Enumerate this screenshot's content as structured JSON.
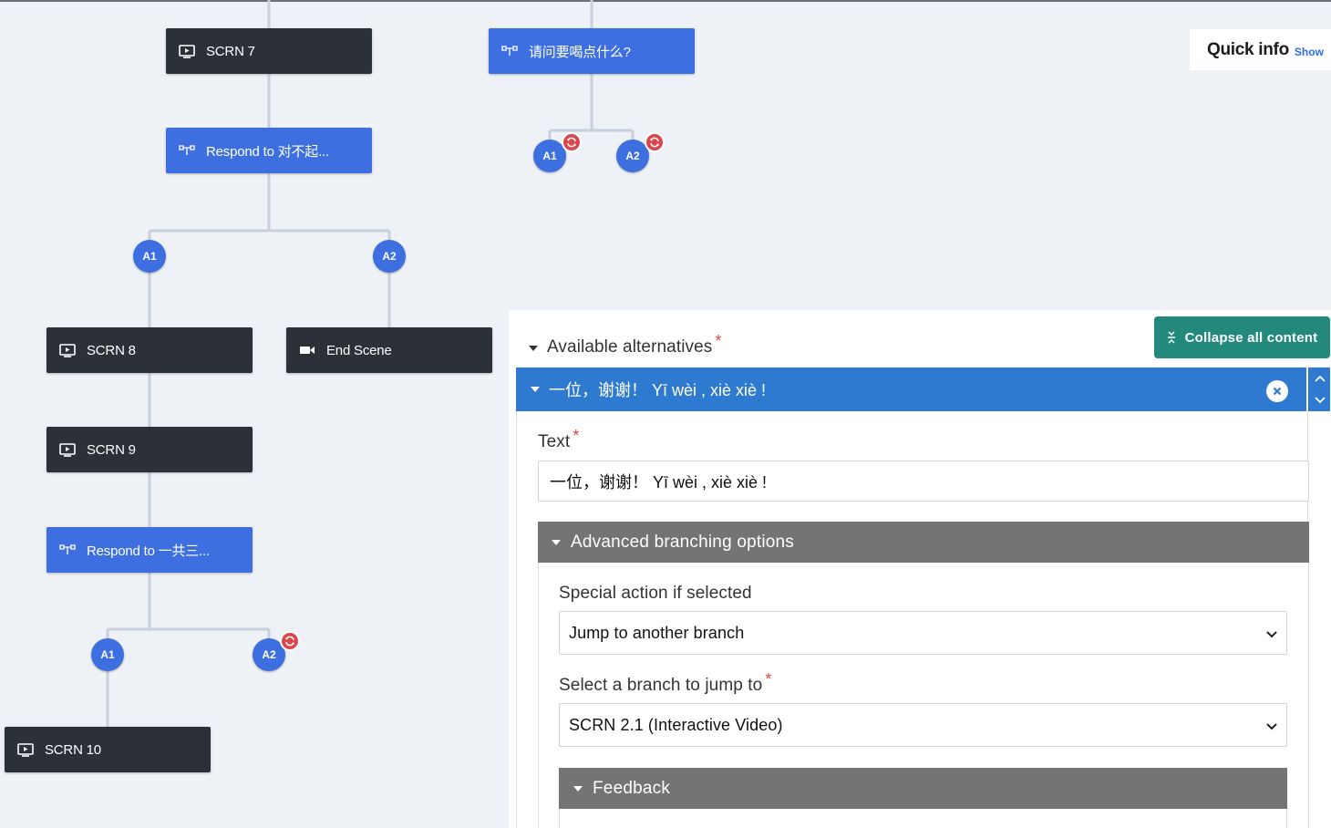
{
  "tree": {
    "nodes": {
      "scrn7": "SCRN 7",
      "question": "请问要喝点什么?",
      "respond1": "Respond to 对不起...",
      "scrn8": "SCRN 8",
      "end_scene": "End Scene",
      "scrn9": "SCRN 9",
      "respond2": "Respond to 一共三...",
      "scrn10": "SCRN 10"
    },
    "alternatives": {
      "a1": "A1",
      "a2": "A2"
    }
  },
  "quick_info": {
    "title": "Quick info",
    "show_label": "Show"
  },
  "editor": {
    "collapse_label": "Collapse all content",
    "available_alternatives_label": "Available alternatives",
    "required_mark": "*",
    "alternative_title": "一位，谢谢！ Yī wèi , xiè xiè !",
    "text_label": "Text",
    "text_value": "一位，谢谢！ Yī wèi , xiè xiè !",
    "advanced_label": "Advanced branching options",
    "special_action_label": "Special action if selected",
    "special_action_value": "Jump to another branch",
    "branch_label": "Select a branch to jump to",
    "branch_value": "SCRN 2.1 (Interactive Video)",
    "feedback_label": "Feedback"
  },
  "colors": {
    "dark_node": "#2c3038",
    "blue_node": "#3e6fe0",
    "loop_badge": "#d9474c",
    "collapse_button": "#22897c",
    "alternative_header": "#2f7ad1",
    "section_header": "#747476"
  },
  "icons": {
    "screen": "screen-icon",
    "question": "branching-question-icon",
    "video": "video-camera-icon",
    "loop": "loop-icon",
    "remove": "remove-icon",
    "collapse": "collapse-icon",
    "chevron": "chevron-down-icon"
  }
}
